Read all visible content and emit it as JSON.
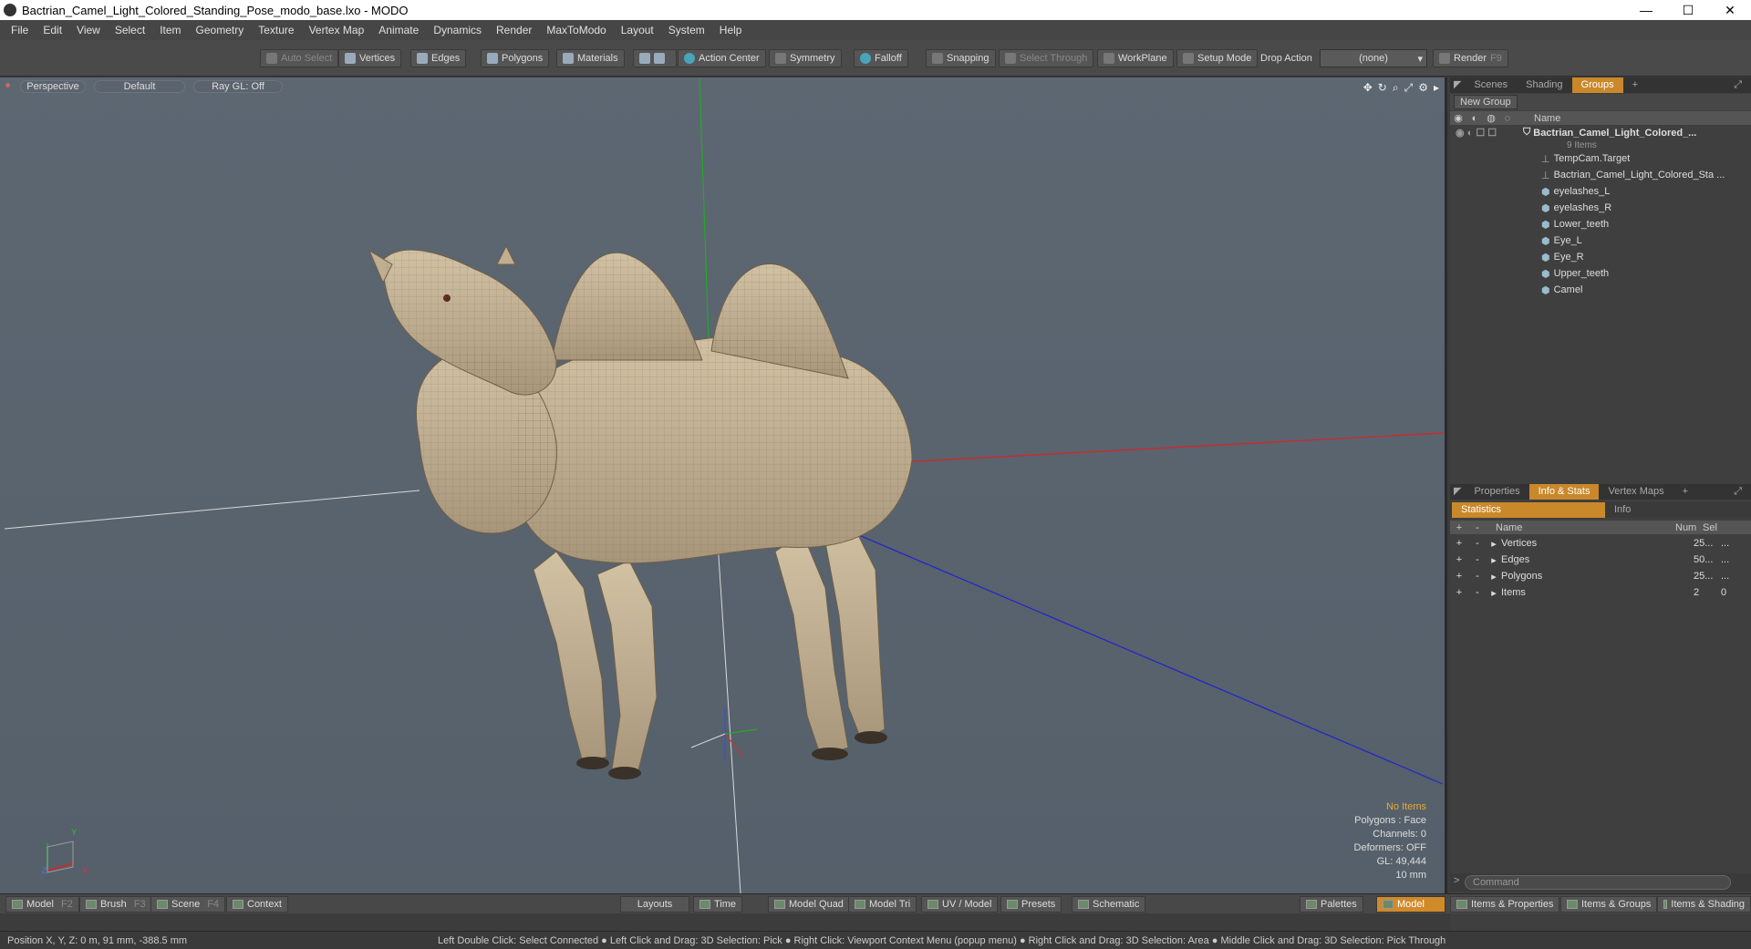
{
  "window": {
    "title": "Bactrian_Camel_Light_Colored_Standing_Pose_modo_base.lxo - MODO",
    "minimize": "—",
    "maximize": "☐",
    "close": "✕"
  },
  "menu": [
    "File",
    "Edit",
    "View",
    "Select",
    "Item",
    "Geometry",
    "Texture",
    "Vertex Map",
    "Animate",
    "Dynamics",
    "Render",
    "MaxToModo",
    "Layout",
    "System",
    "Help"
  ],
  "toolbar": {
    "auto_select": "Auto Select",
    "vertices": "Vertices",
    "edges": "Edges",
    "polygons": "Polygons",
    "materials": "Materials",
    "action_center": "Action Center",
    "symmetry": "Symmetry",
    "falloff": "Falloff",
    "snapping": "Snapping",
    "select_through": "Select Through",
    "workplane": "WorkPlane",
    "setup_mode": "Setup Mode",
    "drop_action": "Drop Action",
    "drop_value": "(none)",
    "render": "Render",
    "render_key": "F9"
  },
  "viewport": {
    "view": "Perspective",
    "shading": "Default",
    "raygl": "Ray GL: Off",
    "info": {
      "items": "No Items",
      "polygons": "Polygons : Face",
      "channels": "Channels: 0",
      "deformers": "Deformers: OFF",
      "gl": "GL: 49,444",
      "scale": "10 mm"
    },
    "axes": {
      "y": "Y",
      "x": "X",
      "z": "Z"
    }
  },
  "scene_panel": {
    "tabs": [
      "Scenes",
      "Shading",
      "Groups"
    ],
    "new_group": "New Group",
    "name_header": "Name",
    "root": {
      "name": "Bactrian_Camel_Light_Colored_...",
      "count": "9 Items"
    },
    "items": [
      "TempCam.Target",
      "Bactrian_Camel_Light_Colored_Sta ...",
      "eyelashes_L",
      "eyelashes_R",
      "Lower_teeth",
      "Eye_L",
      "Eye_R",
      "Upper_teeth",
      "Camel"
    ]
  },
  "props_panel": {
    "tabs": [
      "Properties",
      "Info & Stats",
      "Vertex Maps"
    ],
    "subtabs": [
      "Statistics",
      "Info"
    ],
    "headers": {
      "name": "Name",
      "num": "Num",
      "sel": "Sel"
    },
    "rows": [
      {
        "name": "Vertices",
        "num": "25...",
        "sel": "..."
      },
      {
        "name": "Edges",
        "num": "50...",
        "sel": "..."
      },
      {
        "name": "Polygons",
        "num": "25...",
        "sel": "..."
      },
      {
        "name": "Items",
        "num": "2",
        "sel": "0"
      }
    ],
    "command_placeholder": "Command"
  },
  "bottom": {
    "model": "Model",
    "model_key": "F2",
    "brush": "Brush",
    "brush_key": "F3",
    "scene": "Scene",
    "scene_key": "F4",
    "context": "Context",
    "layouts": "Layouts",
    "time": "Time",
    "model_quad": "Model Quad",
    "model_tri": "Model Tri",
    "uv_model": "UV / Model",
    "presets": "Presets",
    "schematic": "Schematic",
    "palettes": "Palettes",
    "model_active": "Model",
    "items_props": "Items & Properties",
    "items_groups": "Items & Groups",
    "items_shading": "Items & Shading"
  },
  "status": {
    "position": "Position X, Y, Z:   0 m, 91 mm, -388.5 mm",
    "hint": "Left Double Click: Select Connected ● Left Click and Drag: 3D Selection: Pick ● Right Click: Viewport Context Menu (popup menu) ● Right Click and Drag: 3D Selection: Area ● Middle Click and Drag: 3D Selection: Pick Through"
  }
}
